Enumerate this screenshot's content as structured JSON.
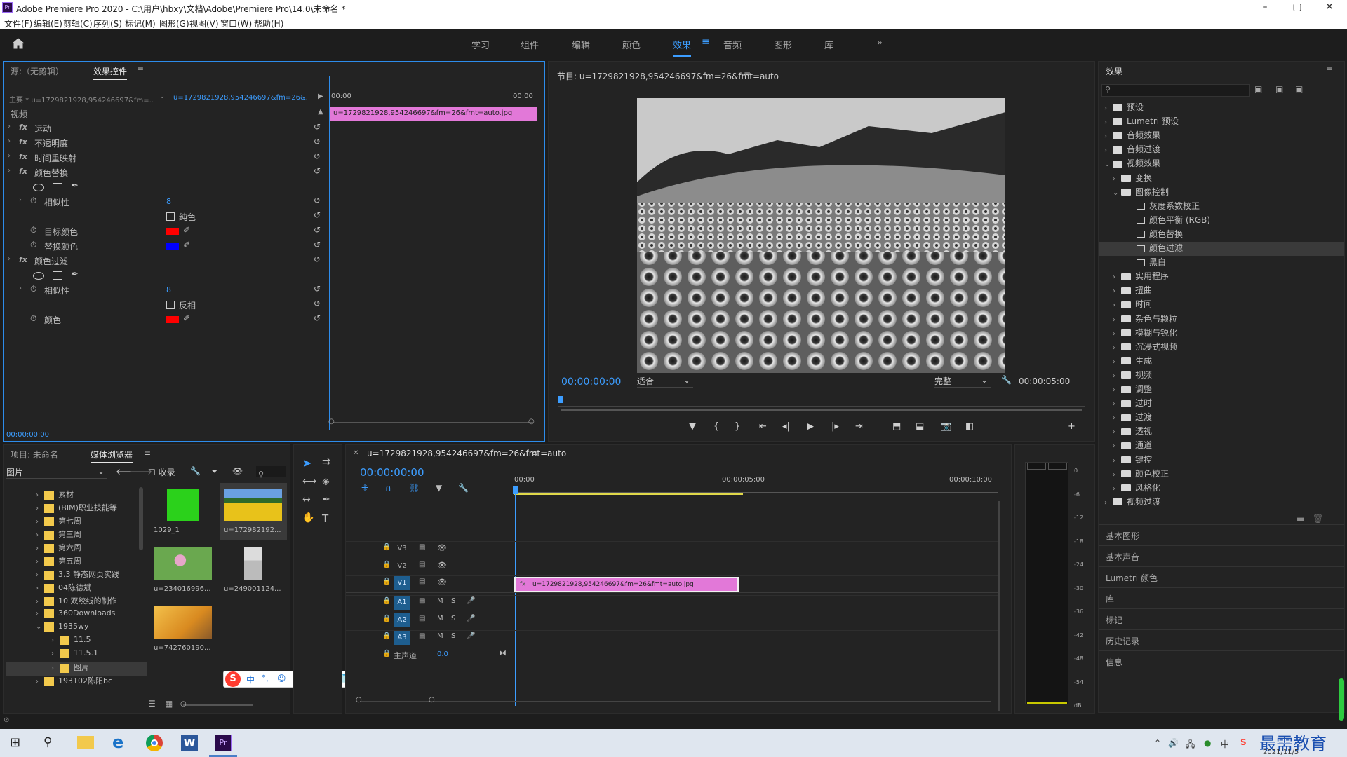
{
  "window": {
    "title": "Adobe Premiere Pro 2020 - C:\\用户\\hbxy\\文档\\Adobe\\Premiere Pro\\14.0\\未命名 *",
    "app_icon": "Pr"
  },
  "menu": [
    "文件(F)",
    "编辑(E)",
    "剪辑(C)",
    "序列(S)",
    "标记(M)",
    "图形(G)",
    "视图(V)",
    "窗口(W)",
    "帮助(H)"
  ],
  "workspaces": [
    "学习",
    "组件",
    "编辑",
    "颜色",
    "效果",
    "音频",
    "图形",
    "库"
  ],
  "active_workspace": "效果",
  "source_panel": {
    "tab1": "源:（无剪辑）",
    "tab2": "效果控件",
    "master": "主要 * u=1729821928,954246697&fm=...",
    "clip": "u=1729821928,954246697&fm=26&...",
    "section_video": "视频",
    "time_start": "00:00",
    "time_end": "00:00",
    "clip_bar": "u=1729821928,954246697&fm=26&fmt=auto.jpg",
    "timecode": "00:00:00:00",
    "effects": [
      {
        "label": "运动",
        "type": "fx"
      },
      {
        "label": "不透明度",
        "type": "fx"
      },
      {
        "label": "时间重映射",
        "type": "fx"
      },
      {
        "label": "颜色替换",
        "type": "fx"
      },
      {
        "label": "",
        "type": "masks"
      },
      {
        "label": "相似性",
        "type": "param",
        "value": "8"
      },
      {
        "label": "纯色",
        "type": "checkbox"
      },
      {
        "label": "目标颜色",
        "type": "color",
        "color": "#ff0000"
      },
      {
        "label": "替换颜色",
        "type": "color",
        "color": "#0000ff"
      },
      {
        "label": "颜色过滤",
        "type": "fx"
      },
      {
        "label": "",
        "type": "masks"
      },
      {
        "label": "相似性",
        "type": "param",
        "value": "8"
      },
      {
        "label": "反相",
        "type": "checkbox"
      },
      {
        "label": "颜色",
        "type": "color",
        "color": "#ff0000"
      }
    ]
  },
  "program": {
    "title": "节目: u=1729821928,954246697&fm=26&fmt=auto",
    "timecode": "00:00:00:00",
    "fit": "适合",
    "quality": "完整",
    "duration": "00:00:05:00"
  },
  "effects_panel": {
    "title": "效果",
    "search_placeholder": "",
    "items": [
      {
        "label": "预设",
        "level": 0,
        "kind": "folder"
      },
      {
        "label": "Lumetri 预设",
        "level": 0,
        "kind": "folder"
      },
      {
        "label": "音频效果",
        "level": 0,
        "kind": "folder"
      },
      {
        "label": "音频过渡",
        "level": 0,
        "kind": "folder"
      },
      {
        "label": "视频效果",
        "level": 0,
        "kind": "folder",
        "open": true
      },
      {
        "label": "变换",
        "level": 1,
        "kind": "folder"
      },
      {
        "label": "图像控制",
        "level": 1,
        "kind": "folder",
        "open": true
      },
      {
        "label": "灰度系数校正",
        "level": 2,
        "kind": "preset"
      },
      {
        "label": "颜色平衡 (RGB)",
        "level": 2,
        "kind": "preset"
      },
      {
        "label": "颜色替换",
        "level": 2,
        "kind": "preset"
      },
      {
        "label": "颜色过滤",
        "level": 2,
        "kind": "preset",
        "selected": true
      },
      {
        "label": "黑白",
        "level": 2,
        "kind": "preset"
      },
      {
        "label": "实用程序",
        "level": 1,
        "kind": "folder"
      },
      {
        "label": "扭曲",
        "level": 1,
        "kind": "folder"
      },
      {
        "label": "时间",
        "level": 1,
        "kind": "folder"
      },
      {
        "label": "杂色与颗粒",
        "level": 1,
        "kind": "folder"
      },
      {
        "label": "模糊与锐化",
        "level": 1,
        "kind": "folder"
      },
      {
        "label": "沉浸式视频",
        "level": 1,
        "kind": "folder"
      },
      {
        "label": "生成",
        "level": 1,
        "kind": "folder"
      },
      {
        "label": "视频",
        "level": 1,
        "kind": "folder"
      },
      {
        "label": "调整",
        "level": 1,
        "kind": "folder"
      },
      {
        "label": "过时",
        "level": 1,
        "kind": "folder"
      },
      {
        "label": "过渡",
        "level": 1,
        "kind": "folder"
      },
      {
        "label": "透视",
        "level": 1,
        "kind": "folder"
      },
      {
        "label": "通道",
        "level": 1,
        "kind": "folder"
      },
      {
        "label": "键控",
        "level": 1,
        "kind": "folder"
      },
      {
        "label": "颜色校正",
        "level": 1,
        "kind": "folder"
      },
      {
        "label": "风格化",
        "level": 1,
        "kind": "folder"
      },
      {
        "label": "视频过渡",
        "level": 0,
        "kind": "folder"
      }
    ],
    "sections": [
      "基本图形",
      "基本声音",
      "Lumetri 颜色",
      "库",
      "标记",
      "历史记录",
      "信息"
    ]
  },
  "project": {
    "tab1": "项目: 未命名",
    "tab2": "媒体浏览器",
    "dropdown": "图片",
    "favorite": "收录",
    "tree": [
      {
        "label": "素材",
        "level": 0
      },
      {
        "label": "(BIM)职业技能等",
        "level": 0
      },
      {
        "label": "第七周",
        "level": 0
      },
      {
        "label": "第三周",
        "level": 0
      },
      {
        "label": "第六周",
        "level": 0
      },
      {
        "label": "第五周",
        "level": 0
      },
      {
        "label": "3.3 静态网页实践",
        "level": 0
      },
      {
        "label": "04陈德斌",
        "level": 0
      },
      {
        "label": "10 双绞线的制作",
        "level": 0
      },
      {
        "label": "360Downloads",
        "level": 0
      },
      {
        "label": "1935wy",
        "level": 0,
        "open": true
      },
      {
        "label": "11.5",
        "level": 1
      },
      {
        "label": "11.5.1",
        "level": 1
      },
      {
        "label": "图片",
        "level": 1,
        "selected": true
      },
      {
        "label": "193102陈阳bc",
        "level": 0
      }
    ],
    "thumbs": [
      {
        "label": "1029_1",
        "kind": "green"
      },
      {
        "label": "u=172982192...",
        "kind": "sunflower",
        "selected": true
      },
      {
        "label": "u=234016996...",
        "kind": "flower"
      },
      {
        "label": "u=249001124...",
        "kind": "gray"
      },
      {
        "label": "u=742760190...",
        "kind": "autumn"
      }
    ]
  },
  "timeline": {
    "tab": "u=1729821928,954246697&fm=26&fmt=auto",
    "timecode": "00:00:00:00",
    "ruler": [
      "00:00",
      "00:00:05:00",
      "00:00:10:00"
    ],
    "tracks": [
      "V3",
      "V2",
      "V1",
      "A1",
      "A2",
      "A3"
    ],
    "master_label": "主声道",
    "master_value": "0.0",
    "clip": "u=1729821928,954246697&fm=26&fmt=auto.jpg"
  },
  "meter": {
    "scale": [
      "0",
      "-6",
      "-12",
      "-18",
      "-24",
      "-30",
      "-36",
      "-42",
      "-48",
      "-54",
      "dB"
    ]
  },
  "ime": {
    "items": [
      "中",
      "°,",
      "☺",
      "🎤",
      "⌨",
      "♟",
      "👕",
      "▦"
    ]
  },
  "taskbar": {
    "date": "2021/11/5",
    "watermark": "最需教育"
  }
}
